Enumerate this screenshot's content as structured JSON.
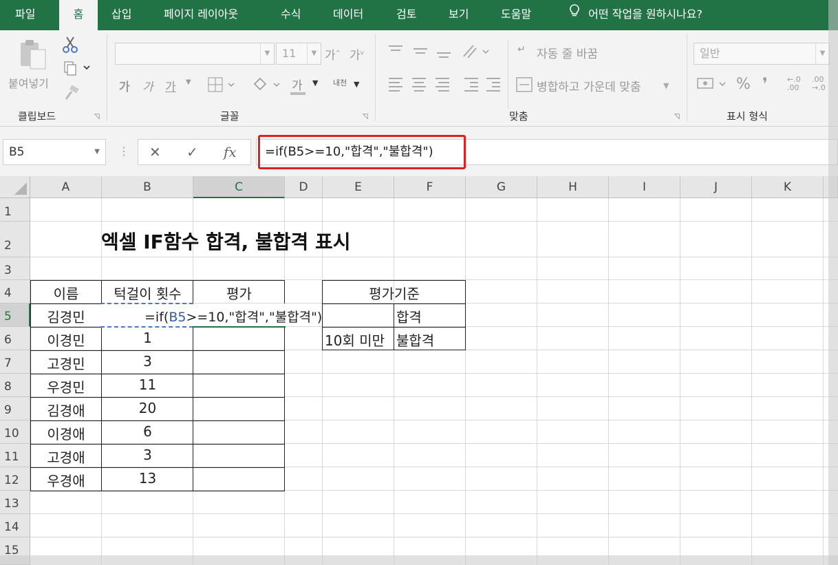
{
  "tabs": [
    "파일",
    "홈",
    "삽입",
    "페이지 레이아웃",
    "수식",
    "데이터",
    "검토",
    "보기",
    "도움말"
  ],
  "active_tab": "홈",
  "tell_me": "어떤 작업을 원하시나요?",
  "ribbon": {
    "clipboard": {
      "paste_label": "붙여넣기",
      "group_label": "클립보드"
    },
    "font": {
      "font_size": "11",
      "grow": "가",
      "shrink": "가",
      "bold": "가",
      "italic": "가",
      "underline": "가",
      "font_color": "가",
      "group_label": "글꼴",
      "phonetic": "내천"
    },
    "alignment": {
      "wrap_text": "자동 줄 바꿈",
      "merge_center": "병합하고 가운데 맞춤",
      "group_label": "맞춤"
    },
    "number": {
      "format": "일반",
      "percent": "%",
      "comma": "❜",
      "inc_decimal": "←.0\n.00",
      "dec_decimal": ".00\n→.0",
      "group_label": "표시 형식"
    }
  },
  "formula_bar": {
    "name_box": "B5",
    "cancel": "✕",
    "enter": "✓",
    "fx": "fx",
    "formula": "=if(B5>=10,\"합격\",\"불합격\")"
  },
  "grid": {
    "columns": [
      "A",
      "B",
      "C",
      "D",
      "E",
      "F",
      "G",
      "H",
      "I",
      "J",
      "K"
    ],
    "rows": [
      "1",
      "2",
      "3",
      "4",
      "5",
      "6",
      "7",
      "8",
      "9",
      "10",
      "11",
      "12",
      "13",
      "14",
      "15"
    ],
    "title": "엑셀 IF함수 합격, 불합격 표시",
    "headers": {
      "name": "이름",
      "count": "턱걸이 횟수",
      "eval": "평가"
    },
    "records": [
      {
        "name": "김경민",
        "count": ""
      },
      {
        "name": "이경민",
        "count": "1"
      },
      {
        "name": "고경민",
        "count": "3"
      },
      {
        "name": "우경민",
        "count": "11"
      },
      {
        "name": "김경애",
        "count": "20"
      },
      {
        "name": "이경애",
        "count": "6"
      },
      {
        "name": "고경애",
        "count": "3"
      },
      {
        "name": "우경애",
        "count": "13"
      }
    ],
    "edit_text": {
      "prefix": "=if(",
      "ref": "B5",
      "suffix": ">=10,\"합격\",\"불합격\")"
    },
    "criteria": {
      "header": "평가기준",
      "row1": {
        "cond": "",
        "result": "합격"
      },
      "row2": {
        "cond": "10회 미만",
        "result": "불합격"
      }
    }
  }
}
